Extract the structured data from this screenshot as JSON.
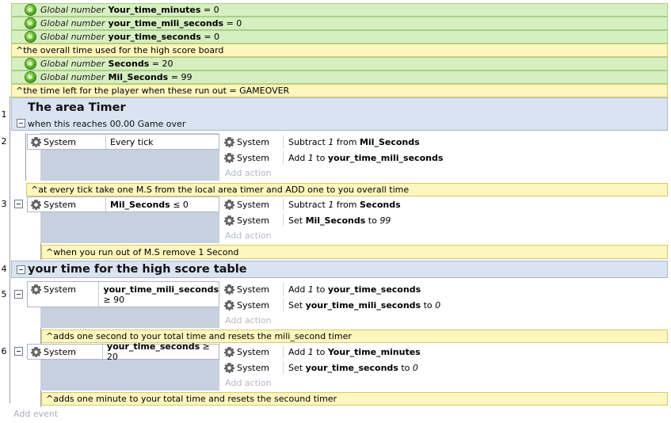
{
  "globals": [
    {
      "keyword": "Global number",
      "name": "Your_time_minutes",
      "value": "= 0"
    },
    {
      "keyword": "Global number",
      "name": "your_time_mili_seconds",
      "value": "= 0"
    },
    {
      "keyword": "Global number",
      "name": "your_time_seconds",
      "value": "= 0"
    },
    {
      "keyword": "Global number",
      "name": "Seconds",
      "value": "= 20"
    },
    {
      "keyword": "Global number",
      "name": "Mil_Seconds",
      "value": "= 99"
    }
  ],
  "comments": {
    "overall_time": "^the overall time used for the high score board",
    "time_left": "^the time left for the player when these run out = GAMEOVER",
    "every_tick": "^at every tick take one M.S from the local area timer and ADD one to you overall time",
    "run_out": "^when you run out of M.S remove 1 Second",
    "adds_second": "^adds one second to your total time and resets the mili_second timer",
    "adds_minute": "^adds one minute to your total time and resets the secound timer"
  },
  "line_numbers": [
    "1",
    "2",
    "3",
    "4",
    "5",
    "6"
  ],
  "group1": {
    "title": "The area Timer",
    "description": "when this reaches 00.00 Game over"
  },
  "group2": {
    "title": "your time for the high score table"
  },
  "object_name": "System",
  "add_action_label": "Add action",
  "add_event_label": "Add event",
  "events": [
    {
      "condition": "Every tick",
      "actions": [
        {
          "pre": "Subtract ",
          "num": "1",
          "mid": " from ",
          "target": "Mil_Seconds",
          "post": ""
        },
        {
          "pre": "Add ",
          "num": "1",
          "mid": " to ",
          "target": "your_time_mili_seconds",
          "post": ""
        }
      ]
    },
    {
      "condition_name": "Mil_Seconds",
      "condition_rest": " ≤ 0",
      "actions": [
        {
          "pre": "Subtract ",
          "num": "1",
          "mid": " from ",
          "target": "Seconds",
          "post": ""
        },
        {
          "pre": "Set ",
          "target": "Mil_Seconds",
          "mid": " to ",
          "num": "99"
        }
      ]
    },
    {
      "condition_name": "your_time_mili_seconds",
      "condition_rest": "≥ 90",
      "actions": [
        {
          "pre": "Add ",
          "num": "1",
          "mid": " to ",
          "target": "your_time_seconds"
        },
        {
          "pre": "Set ",
          "target": "your_time_mili_seconds",
          "mid": " to ",
          "num": "0"
        }
      ]
    },
    {
      "condition_name": "your_time_seconds",
      "condition_rest": " ≥ 20",
      "actions": [
        {
          "pre": "Add ",
          "num": "1",
          "mid": " to ",
          "target": "Your_time_minutes"
        },
        {
          "pre": "Set ",
          "target": "your_time_seconds",
          "mid": " to ",
          "num": "0"
        }
      ]
    }
  ],
  "colors": {
    "global_bg": "#d6efc0",
    "comment_bg": "#fdf6bd",
    "group_bg": "#d9e3f1",
    "event_bg": "#c7d0df"
  }
}
